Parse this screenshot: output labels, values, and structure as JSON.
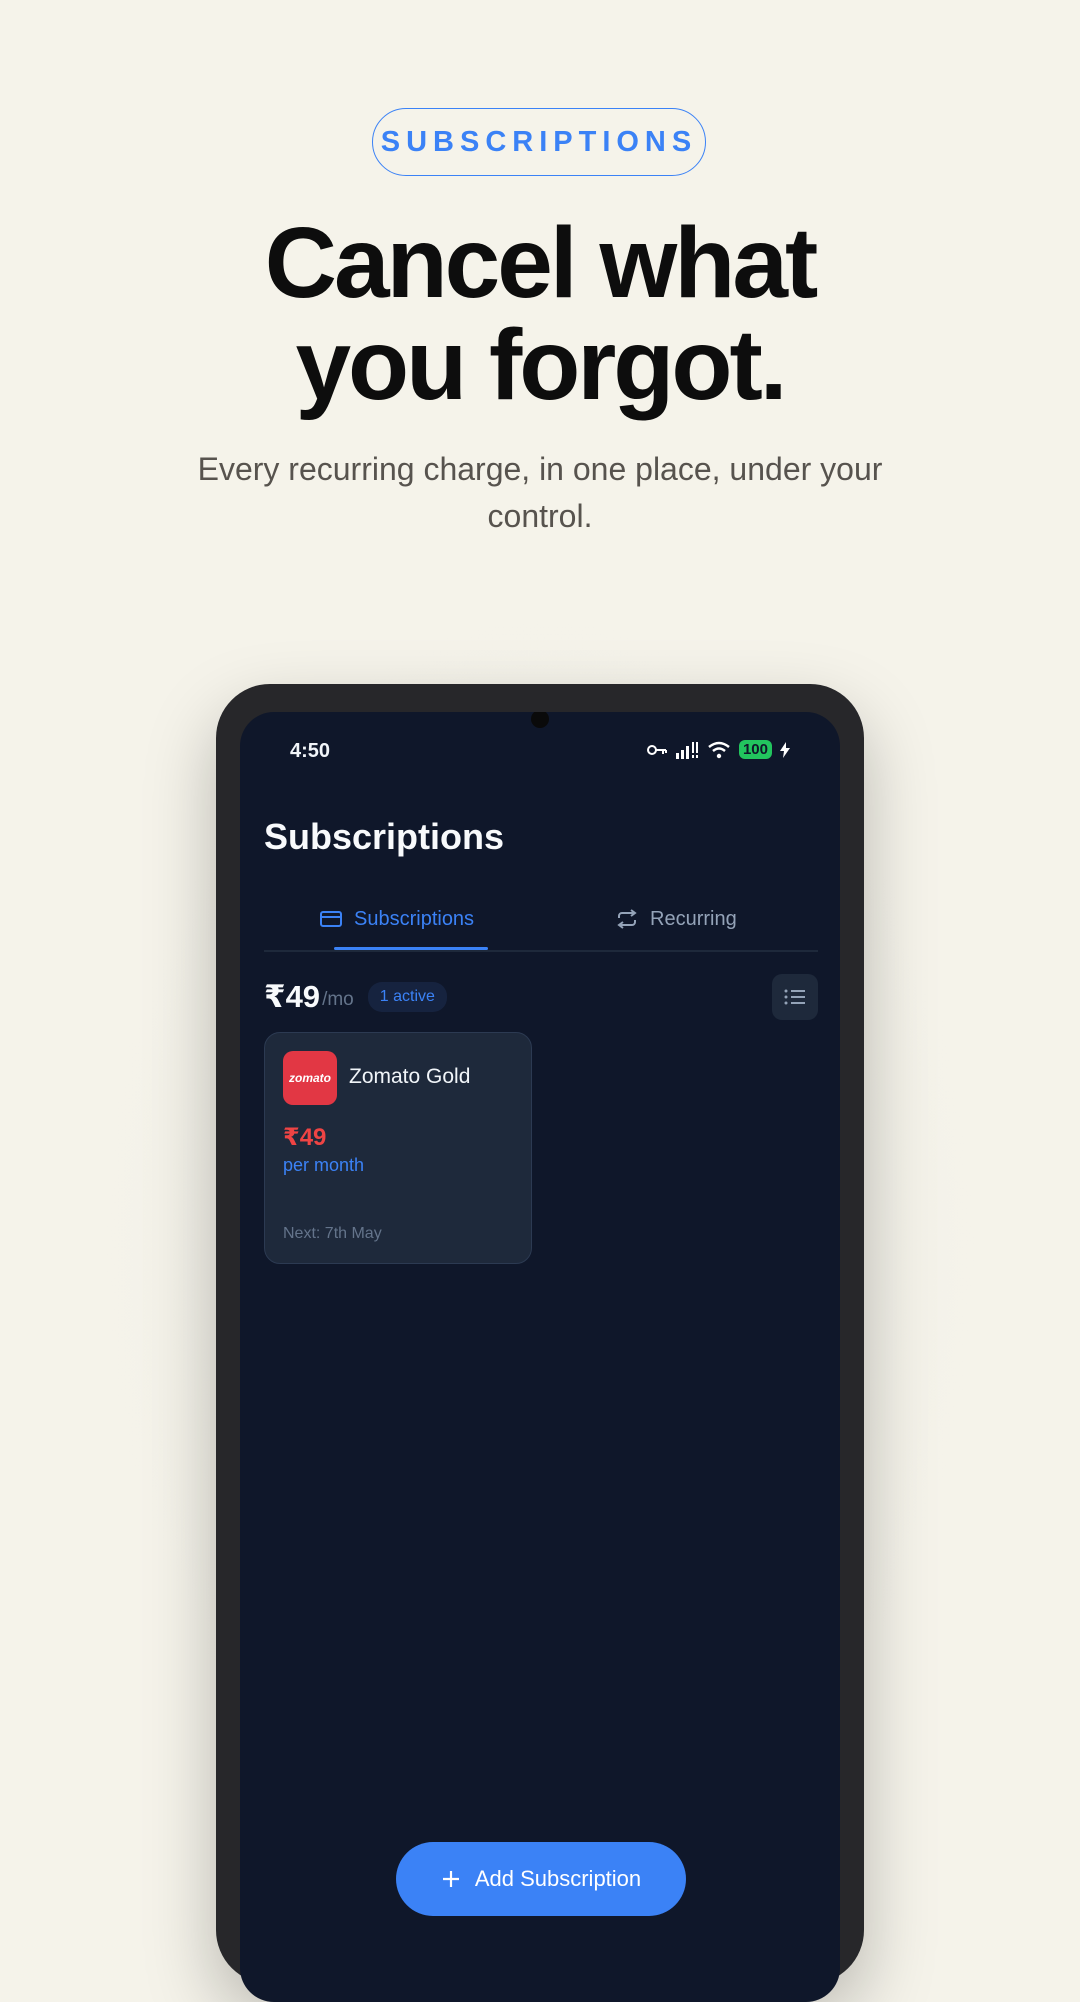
{
  "hero": {
    "badge": "SUBSCRIPTIONS",
    "headline_line1": "Cancel what",
    "headline_line2": "you forgot.",
    "subtext": "Every recurring charge, in one place, under your control."
  },
  "status_bar": {
    "time": "4:50",
    "battery": "100"
  },
  "app": {
    "title": "Subscriptions",
    "tabs": [
      {
        "label": "Subscriptions",
        "icon": "credit-card-icon",
        "active": true
      },
      {
        "label": "Recurring",
        "icon": "repeat-icon",
        "active": false
      }
    ],
    "summary": {
      "amount": "₹49",
      "period": "/mo",
      "active_badge": "1 active"
    },
    "subscriptions": [
      {
        "name": "Zomato Gold",
        "logo_text": "zomato",
        "price": "₹49",
        "period": "per month",
        "next": "Next: 7th May"
      }
    ],
    "add_button": "Add Subscription"
  },
  "colors": {
    "accent": "#3b82f6",
    "price": "#ef4444",
    "screen_bg": "#0f172a",
    "card_bg": "#1e293b",
    "brand_zomato": "#e23744"
  }
}
